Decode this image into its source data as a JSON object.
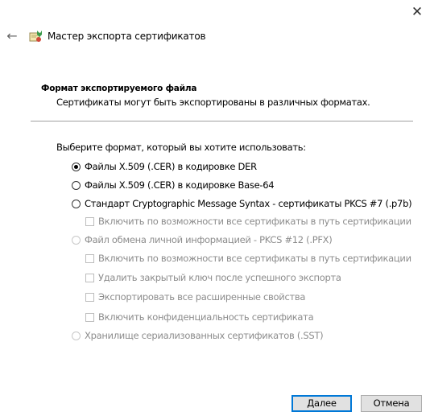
{
  "window": {
    "title": "Мастер экспорта сертификатов",
    "close_glyph": "✕",
    "back_glyph": "←"
  },
  "header": {
    "section_title": "Формат экспортируемого файла",
    "section_subtitle": "Сертификаты могут быть экспортированы в различных форматах."
  },
  "form": {
    "prompt": "Выберите формат, который вы хотите использовать:",
    "options": [
      {
        "label": "Файлы X.509 (.CER) в кодировке DER",
        "type": "radio",
        "checked": true,
        "enabled": true
      },
      {
        "label": "Файлы X.509 (.CER) в кодировке Base-64",
        "type": "radio",
        "checked": false,
        "enabled": true
      },
      {
        "label": "Стандарт Cryptographic Message Syntax - сертификаты PKCS #7 (.p7b)",
        "type": "radio",
        "checked": false,
        "enabled": true
      },
      {
        "label": "Включить по возможности все сертификаты в путь сертификации",
        "type": "checkbox",
        "checked": false,
        "enabled": false
      },
      {
        "label": "Файл обмена личной информацией - PKCS #12 (.PFX)",
        "type": "radio",
        "checked": false,
        "enabled": false
      },
      {
        "label": "Включить по возможности все сертификаты в путь сертификации",
        "type": "checkbox",
        "checked": false,
        "enabled": false
      },
      {
        "label": "Удалить закрытый ключ после успешного экспорта",
        "type": "checkbox",
        "checked": false,
        "enabled": false
      },
      {
        "label": "Экспортировать все расширенные свойства",
        "type": "checkbox",
        "checked": false,
        "enabled": false
      },
      {
        "label": "Включить конфиденциальность сертификата",
        "type": "checkbox",
        "checked": false,
        "enabled": false
      },
      {
        "label": "Хранилище сериализованных сертификатов (.SST)",
        "type": "radio",
        "checked": false,
        "enabled": false
      }
    ]
  },
  "footer": {
    "next_label": "Далее",
    "cancel_label": "Отмена"
  },
  "icons": {
    "wizard": "certificate-wizard-icon",
    "back": "back-arrow-icon",
    "close": "close-icon"
  },
  "colors": {
    "accent": "#0078d7",
    "disabled_text": "#8c8c8c",
    "button_face": "#e1e1e1"
  }
}
